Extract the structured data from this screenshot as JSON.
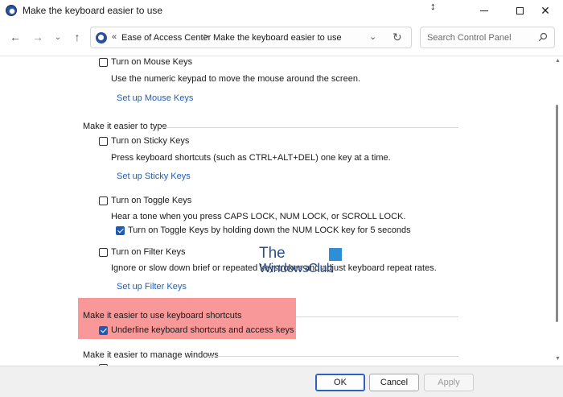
{
  "window": {
    "title": "Make the keyboard easier to use",
    "minimize_glyph": "—",
    "close_glyph": "✕"
  },
  "nav": {
    "back_glyph": "←",
    "forward_glyph": "→",
    "recent_glyph": "⌄",
    "up_glyph": "↑"
  },
  "address": {
    "prefix_glyph": "«",
    "crumb_1": "Ease of Access Center",
    "separator": ">",
    "crumb_2": "Make the keyboard easier to use",
    "dropdown_glyph": "⌄",
    "refresh_glyph": "↻"
  },
  "search": {
    "placeholder": "Search Control Panel"
  },
  "mouse_keys": {
    "checkbox_label": "Turn on Mouse Keys",
    "checked": false,
    "description": "Use the numeric keypad to move the mouse around the screen.",
    "setup_link": "Set up Mouse Keys"
  },
  "typing_section": {
    "heading": "Make it easier to type",
    "sticky": {
      "checkbox_label": "Turn on Sticky Keys",
      "checked": false,
      "description": "Press keyboard shortcuts (such as CTRL+ALT+DEL) one key at a time.",
      "setup_link": "Set up Sticky Keys"
    },
    "toggle": {
      "checkbox_label": "Turn on Toggle Keys",
      "checked": false,
      "description": "Hear a tone when you press CAPS LOCK, NUM LOCK, or SCROLL LOCK.",
      "sub_checkbox_label": "Turn on Toggle Keys by holding down the NUM LOCK key for 5 seconds",
      "sub_checked": true
    },
    "filter": {
      "checkbox_label": "Turn on Filter Keys",
      "checked": false,
      "description": "Ignore or slow down brief or repeated keystrokes and adjust keyboard repeat rates.",
      "setup_link": "Set up Filter Keys"
    }
  },
  "shortcuts_section": {
    "heading": "Make it easier to use keyboard shortcuts",
    "checkbox_label": "Underline keyboard shortcuts and access keys",
    "checked": true
  },
  "windows_section": {
    "heading": "Make it easier to manage windows"
  },
  "watermark": {
    "line_1": "The",
    "line_2": "WindowsClub"
  },
  "footer": {
    "ok_label": "OK",
    "cancel_label": "Cancel",
    "apply_label": "Apply"
  },
  "colors": {
    "link": "#1d5fb8",
    "highlight": "#f78f8f",
    "checkbox_checked": "#1e5bb8"
  }
}
